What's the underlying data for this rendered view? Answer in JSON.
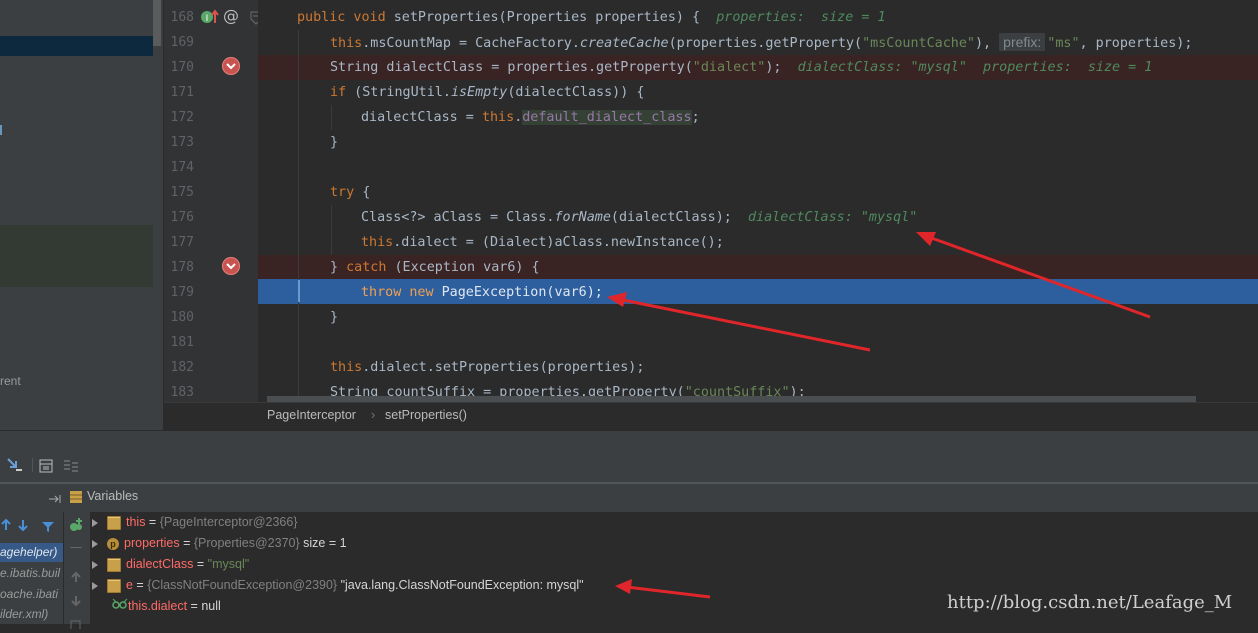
{
  "editor": {
    "line_numbers": [
      "168",
      "169",
      "170",
      "171",
      "172",
      "173",
      "174",
      "175",
      "176",
      "177",
      "178",
      "179",
      "180",
      "181",
      "182",
      "183"
    ],
    "lines": {
      "l168_a": "public void ",
      "l168_b": "setProperties(Properties properties) {  ",
      "l168_hint": "properties:  size = 1",
      "l169_a": "this",
      "l169_b": ".msCountMap = CacheFactory.",
      "l169_c": "createCache",
      "l169_d": "(properties.getProperty(",
      "l169_str": "\"msCountCache\"",
      "l169_e": "), ",
      "l169_prefix": "prefix:",
      "l169_str2": "\"ms\"",
      "l169_f": ", properties);",
      "l170_a": "String dialectClass = properties.getProperty(",
      "l170_str": "\"dialect\"",
      "l170_b": ");  ",
      "l170_hint": "dialectClass: \"mysql\"  properties:  size = 1",
      "l171_kw": "if",
      "l171_b": " (StringUtil.",
      "l171_c": "isEmpty",
      "l171_d": "(dialectClass)) {",
      "l172_a": "dialectClass = ",
      "l172_kw": "this",
      "l172_b": ".",
      "l172_fld": "default_dialect_class",
      "l172_c": ";",
      "l173": "}",
      "l175_kw": "try",
      "l175_b": " {",
      "l176_a": "Class<?> aClass = Class.",
      "l176_c": "forName",
      "l176_d": "(dialectClass);  ",
      "l176_hint": "dialectClass: \"mysql\"",
      "l177_kw": "this",
      "l177_b": ".dialect = (Dialect)aClass.newInstance();",
      "l178_a": "} ",
      "l178_kw": "catch",
      "l178_b": " (Exception var6) {",
      "l179_kw1": "throw",
      "l179_kw2": "new",
      "l179_b": " PageException(var6);",
      "l180": "}",
      "l182_kw": "this",
      "l182_b": ".dialect.setProperties(properties);",
      "l183_a": "String countSuffix = properties.getProperty(",
      "l183_str": "\"countSuffix\"",
      "l183_b": ");"
    }
  },
  "left_panel": {
    "partial_text": "rent"
  },
  "breadcrumb": {
    "class_name": "PageInterceptor",
    "separator": "›",
    "method_name": "setProperties()"
  },
  "debugger": {
    "variables_title": "Variables",
    "frames": [
      "agehelper)",
      "e.ibatis.buil",
      "oache.ibati",
      "ilder.xml)"
    ],
    "variables": [
      {
        "name": "this",
        "eq": " = ",
        "type": "{PageInterceptor@2366}",
        "extra": ""
      },
      {
        "name": "properties",
        "eq": " = ",
        "type": "{Properties@2370}",
        "extra": "  size = 1"
      },
      {
        "name": "dialectClass",
        "eq": " = ",
        "value": "\"mysql\""
      },
      {
        "name": "e",
        "eq": " = ",
        "type": "{ClassNotFoundException@2390}",
        "extra": " \"java.lang.ClassNotFoundException: mysql\""
      },
      {
        "name": "this.dialect",
        "eq": " = ",
        "value": "null"
      }
    ]
  },
  "watermark": "http://blog.csdn.net/Leafage_M",
  "colors": {
    "accent_red_arrow": "#e0262a",
    "exec_line": "#2d5f9e",
    "breakpoint": "#c75450"
  }
}
